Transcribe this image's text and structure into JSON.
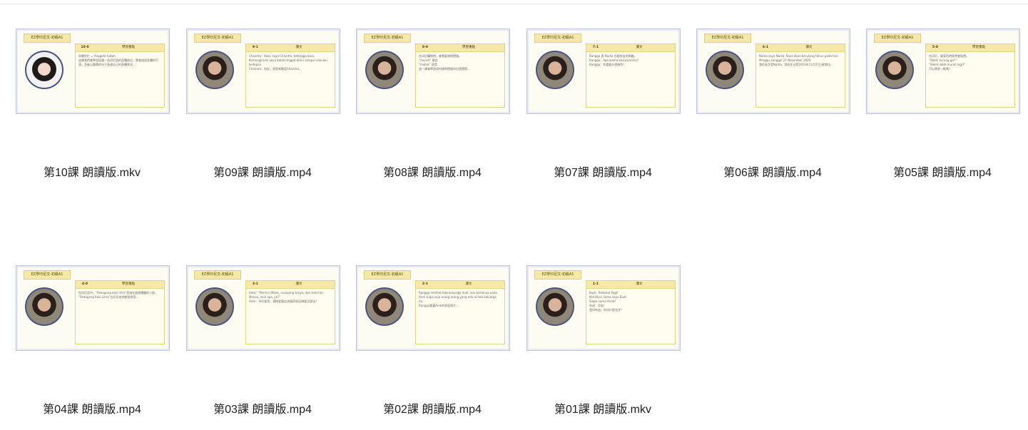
{
  "files": [
    {
      "name": "第10課 朗讀版.mkv",
      "header": "EZ學印尼文-初級A1",
      "code": "10-0",
      "title": "學習重點",
      "text": "與爾別忙 = Anggota tubuh\n這課我們會學習認識一些印尼語的身體部位，學會描述身體的不適，並能以簡單的句子表達自己的身體狀況…",
      "style": "pale"
    },
    {
      "name": "第09課 朗讀版.mp4",
      "header": "EZ學印尼文-初級A1",
      "code": "9-1",
      "title": "課文",
      "text": "Chandra：Halo, saya Chandra, tetangga baru.\nKemungkinan saya bakal tinggal disini sampai sebulan kedepan.\nChandra：你好，我是新鄰居Chandra。",
      "style": "normal"
    },
    {
      "name": "第08課 朗讀版.mp4",
      "header": "EZ學印尼文-初級A1",
      "code": "8-0",
      "title": "學習重點",
      "text": "在印尼購物時，會需要詢問價錢。\n“murah” 便宜\n“mahal” 很貴\n這一課會學習如何詢問價格與討價還價…",
      "style": "normal"
    },
    {
      "name": "第07課 朗讀版.mp4",
      "header": "EZ學印尼文-初級A1",
      "code": "7-1",
      "title": "課文",
      "text": "Rangga 與 Nadia 在聊各自的興趣。\nRangga：Apa wama kesukaanmu?\nRangga：你喜歡什麼顏色？",
      "style": "normal"
    },
    {
      "name": "第06課 朗讀版.mp4",
      "header": "EZ學印尼文-初級A1",
      "code": "6-1",
      "title": "課文",
      "text": "Nama saya Nadia. Saya akan berulang tahun pada hari Minggu, tanggal 27 November 2023.\n我的名字是Nadia。我的生日是2023年11月27日星期日。",
      "style": "normal"
    },
    {
      "name": "第05課 朗讀版.mp4",
      "header": "EZ學印尼文-初級A1",
      "code": "5-0",
      "title": "學習重點",
      "text": "在印尼，買東西時經常會殺價。\n“Boleh kurang ga?”\n“Boleh lebih murah lagi?”\n可以便宜一點嗎？",
      "style": "normal"
    },
    {
      "name": "第04課 朗讀版.mp4",
      "header": "EZ學印尼文-初級A1",
      "code": "4-0",
      "title": "學習重點",
      "text": "在印尼話中，“Pedagang kaki lima”是指在路邊擺攤的小販，\n“Pedagang Kaki Lima”在印尼各地都很常見…",
      "style": "normal"
    },
    {
      "name": "第03課 朗讀版.mp4",
      "header": "EZ學印尼文-初級A1",
      "code": "3-1",
      "title": "課文",
      "text": "Anto：“Permisi Mbak, numpang tanya, dari hotel ke Monas, naik apa, ya?”\nAnto：不好意思，請問從飯店到國家紀念碑要怎麼去？",
      "style": "normal"
    },
    {
      "name": "第02課 朗讀版.mp4",
      "header": "EZ學印尼文-初級A1",
      "code": "2-1",
      "title": "課文",
      "text": "Rangga melihat foto keluarga Andi, lalu bertanya pada Andi siapa saja orang-orang yang ada di foto keluarga itu.\nRangga看著Andi的家庭照片…",
      "style": "normal"
    },
    {
      "name": "第01課 朗讀版.mkv",
      "header": "EZ學印尼文-初級A1",
      "code": "1-1",
      "title": "課文",
      "text": "Budi：Selamat Pagi!\nKenalkan nama saya Budi.\nSiapa nama Anda?\n布迪：早安！\n我叫布迪，你叫什麼名字？",
      "style": "normal"
    }
  ]
}
